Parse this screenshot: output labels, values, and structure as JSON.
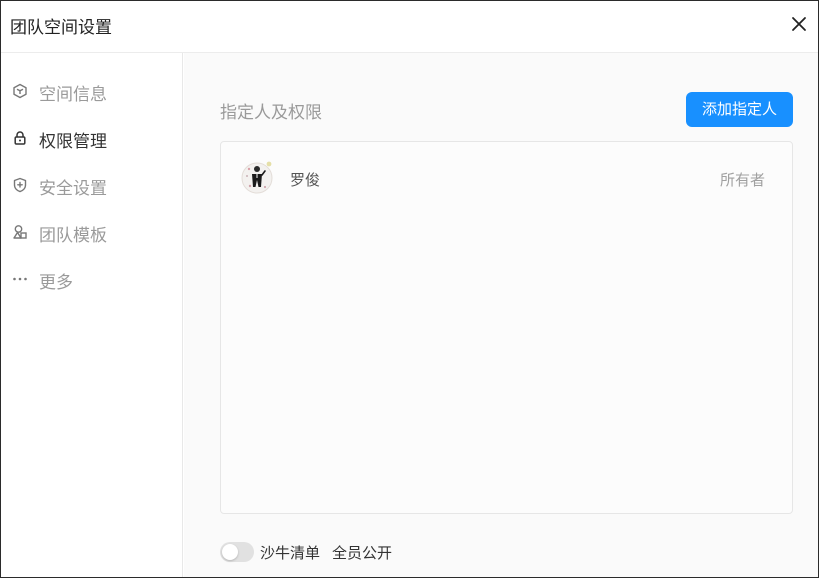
{
  "dialog": {
    "title": "团队空间设置",
    "close_icon": "close-icon"
  },
  "sidebar": {
    "items": [
      {
        "label": "空间信息",
        "icon": "cube-icon",
        "active": false
      },
      {
        "label": "权限管理",
        "icon": "lock-icon",
        "active": true
      },
      {
        "label": "安全设置",
        "icon": "shield-icon",
        "active": false
      },
      {
        "label": "团队模板",
        "icon": "shapes-icon",
        "active": false
      },
      {
        "label": "更多",
        "icon": "more-icon",
        "active": false
      }
    ]
  },
  "main": {
    "section_title": "指定人及权限",
    "add_button_label": "添加指定人",
    "members": [
      {
        "name": "罗俊",
        "role": "所有者"
      }
    ],
    "footer": {
      "toggle_label": "沙牛清单",
      "toggle_sub_label": "全员公开",
      "toggle_on": false
    }
  },
  "colors": {
    "accent": "#1890ff",
    "text_primary": "#333333",
    "text_muted": "#9a9a9a"
  }
}
